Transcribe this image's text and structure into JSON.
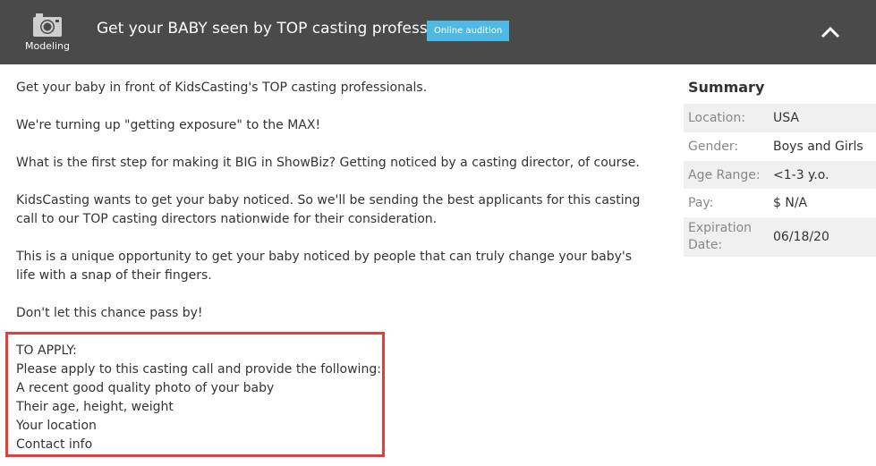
{
  "header": {
    "category_icon": "camera-icon",
    "category_label": "Modeling",
    "title": "Get your BABY seen by TOP casting professionals",
    "badge": "Online audition",
    "collapse_icon": "chevron-up-icon"
  },
  "description": {
    "paragraphs": [
      "Get your baby in front of KidsCasting's TOP casting professionals.",
      "We're turning up \"getting exposure\" to the MAX!",
      "What is the first step for making it BIG in ShowBiz? Getting noticed by a casting director, of course.",
      "KidsCasting wants to get your baby noticed. So we'll be sending the best applicants for this casting call to our TOP casting directors nationwide for their consideration.",
      "This is a unique opportunity to get your baby noticed by people that can truly change your baby's life with a snap of their fingers.",
      "Don't let this chance pass by!"
    ]
  },
  "apply": {
    "lines": [
      "TO APPLY:",
      "Please apply to this casting call and provide the following:",
      "A recent good quality photo of your baby",
      "Their age, height, weight",
      "Your location",
      "Contact info"
    ],
    "highlight_color": "#e0403c"
  },
  "summary": {
    "heading": "Summary",
    "rows": [
      {
        "label": "Location:",
        "value": "USA"
      },
      {
        "label": "Gender:",
        "value": "Boys and Girls"
      },
      {
        "label": "Age Range:",
        "value": "<1-3 y.o."
      },
      {
        "label": "Pay:",
        "value": "$ N/A"
      },
      {
        "label": "Expiration Date:",
        "value": "06/18/20"
      }
    ]
  },
  "colors": {
    "header_bg": "#4a4a4a",
    "badge_bg": "#4fb9e6"
  }
}
